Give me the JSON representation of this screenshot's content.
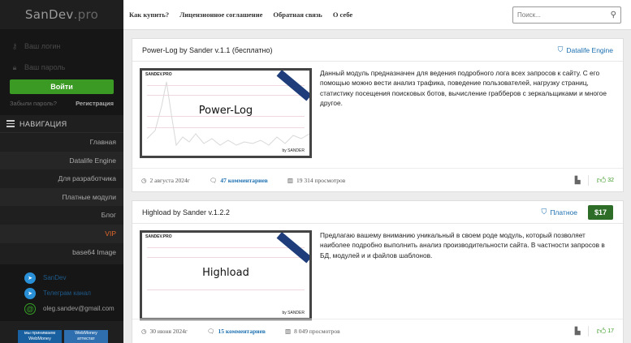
{
  "sidebar": {
    "logo_main": "SanDev",
    "logo_suffix": ".pro",
    "login": {
      "username_placeholder": "Ваш логин",
      "password_placeholder": "Ваш пароль",
      "submit_label": "Войти",
      "forgot_label": "Забыли пароль?",
      "register_label": "Регистрация"
    },
    "nav_heading": "НАВИГАЦИЯ",
    "nav_items": [
      {
        "label": "Главная"
      },
      {
        "label": "Datalife Engine"
      },
      {
        "label": "Для разработчика"
      },
      {
        "label": "Платные модули"
      },
      {
        "label": "Блог"
      },
      {
        "label": "VIP"
      },
      {
        "label": "base64 Image"
      }
    ],
    "contacts": [
      {
        "label": "SanDev",
        "icon": "telegram-icon"
      },
      {
        "label": "Телеграм канал",
        "icon": "telegram-icon"
      },
      {
        "label": "oleg.sandev@gmail.com",
        "icon": "at-icon"
      }
    ],
    "payment_badges": [
      {
        "line1": "мы принимаем",
        "line2": "WebMoney"
      },
      {
        "line1": "WebMoney",
        "line2": "аттестат"
      }
    ]
  },
  "topbar": {
    "links": [
      "Как купить?",
      "Лицензионное соглашение",
      "Обратная связь",
      "О себе"
    ],
    "search_placeholder": "Поиск..."
  },
  "posts": [
    {
      "title": "Power-Log by Sander v.1.1 (бесплатно)",
      "category": "Datalife Engine",
      "price": "",
      "thumb_brand": "SANDEV.PRO",
      "thumb_name": "Power-Log",
      "thumb_by": "by SANDER",
      "description": "Данный модуль предназначен для ведения подробного лога всех запросов к сайту. С его помощью можно вести анализ трафика, поведение пользователей, нагрузку страниц, статистику посещения поисковых ботов, вычисление грабберов с зеркальщиками и многое другое.",
      "date": "2 августа 2024г",
      "comments": "47 комментариев",
      "views": "19 314 просмотров",
      "likes": "32"
    },
    {
      "title": "Highload by Sander v.1.2.2",
      "category": "Платное",
      "price": "$17",
      "thumb_brand": "SANDEV.PRO",
      "thumb_name": "Highload",
      "thumb_by": "by SANDER",
      "description": "Предлагаю вашему вниманию уникальный в своем роде модуль, который позволяет наиболее подробно выполнить анализ производительности сайта. В частности запросов в БД, модулей и и файлов шаблонов.",
      "date": "30 июня 2024г",
      "comments": "15 комментариев",
      "views": "8 049 просмотров",
      "likes": "17"
    }
  ],
  "colors": {
    "accent_green": "#3a9a23",
    "link_blue": "#1b6fb0",
    "vip_orange": "#e0672a",
    "sidebar_bg": "#1f1f1f"
  }
}
